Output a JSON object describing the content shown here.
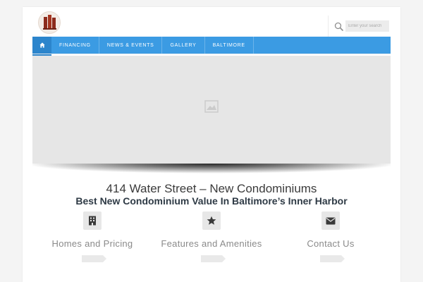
{
  "header": {
    "logo_icon": "building-logo-icon",
    "search": {
      "placeholder": "Enter your search",
      "value": ""
    }
  },
  "nav": {
    "home_icon": "home-icon",
    "items": [
      {
        "label": "FINANCING"
      },
      {
        "label": "NEWS & EVENTS"
      },
      {
        "label": "GALLERY"
      },
      {
        "label": "BALTIMORE"
      }
    ]
  },
  "slider": {
    "icon": "image-placeholder-icon"
  },
  "content": {
    "title": "414 Water Street – New Condominiums",
    "subtitle": "Best New Condominium Value In Baltimore’s Inner Harbor"
  },
  "features": [
    {
      "icon": "building-icon",
      "label": "Homes and Pricing"
    },
    {
      "icon": "star-icon",
      "label": "Features and Amenities"
    },
    {
      "icon": "envelope-icon",
      "label": "Contact Us"
    }
  ],
  "colors": {
    "nav_bg": "#3b9be3",
    "nav_active": "#2c85cc",
    "title_text": "#3b3b3b",
    "subtitle_text": "#2e3a45",
    "feature_text": "#8a8a8a"
  }
}
